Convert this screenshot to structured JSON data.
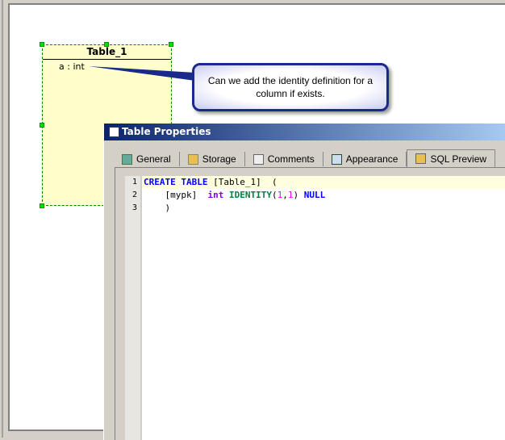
{
  "entity": {
    "name": "Table_1",
    "columns": [
      {
        "label": "a : int"
      }
    ]
  },
  "callout": {
    "text": "Can we add the identity definition for a column if exists."
  },
  "dialog": {
    "title": "Table Properties",
    "tabs": [
      {
        "label": "General",
        "icon": "grid-icon"
      },
      {
        "label": "Storage",
        "icon": "storage-icon"
      },
      {
        "label": "Comments",
        "icon": "comments-icon"
      },
      {
        "label": "Appearance",
        "icon": "appearance-icon"
      },
      {
        "label": "SQL Preview",
        "icon": "sql-preview-icon",
        "active": true
      }
    ],
    "sql": {
      "line_numbers": [
        "1",
        "2",
        "3"
      ],
      "l1": {
        "k1": "CREATE",
        "k2": "TABLE",
        "rest": " [Table_1]  ("
      },
      "l2": {
        "indent": "    [mypk]  ",
        "type": "int",
        "fn": "IDENTITY",
        "p1": "(",
        "n1": "1",
        "c": ",",
        "n2": "1",
        "p2": ")",
        "sp": " ",
        "null": "NULL"
      },
      "l3": {
        "text": "    )"
      }
    }
  }
}
